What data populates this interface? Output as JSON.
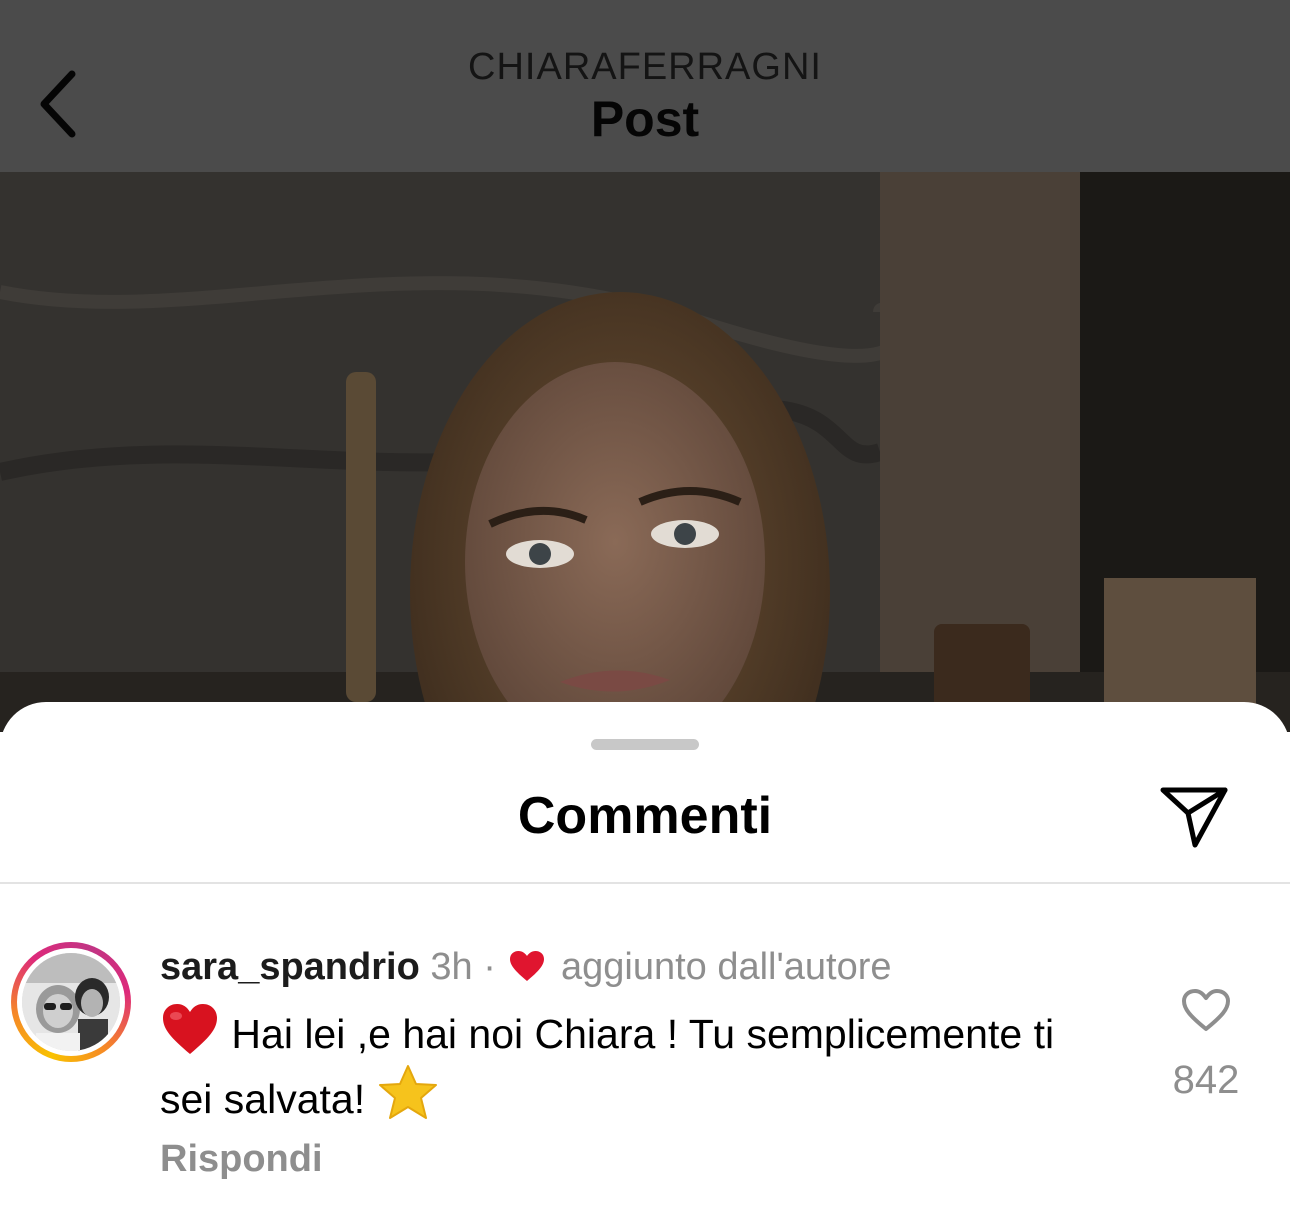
{
  "header": {
    "back_icon": "chevron-left-icon",
    "owner": "CHIARAFERRAGNI",
    "title": "Post"
  },
  "sheet": {
    "title": "Commenti",
    "share_icon": "paper-plane-icon"
  },
  "comment": {
    "username": "sara_spandrio",
    "time": "3h",
    "separator": "·",
    "liked_by_author_icon": "heart-filled-icon",
    "liked_by_author_label": "aggiunto dall'autore",
    "text_before_heart": "",
    "text": "Hai lei ,e hai noi Chiara ! Tu semplicemente ti sei salvata!",
    "leading_emoji": "red-heart-emoji-icon",
    "trailing_emoji": "star-emoji-icon",
    "reply_label": "Rispondi",
    "like_icon": "heart-outline-icon",
    "like_count": "842"
  },
  "colors": {
    "header_dim": "#4b4b4b",
    "muted_text": "#8e8e8e",
    "heart_red": "#e0152f",
    "story_ring_start": "#f9c200",
    "story_ring_end": "#c13584"
  }
}
